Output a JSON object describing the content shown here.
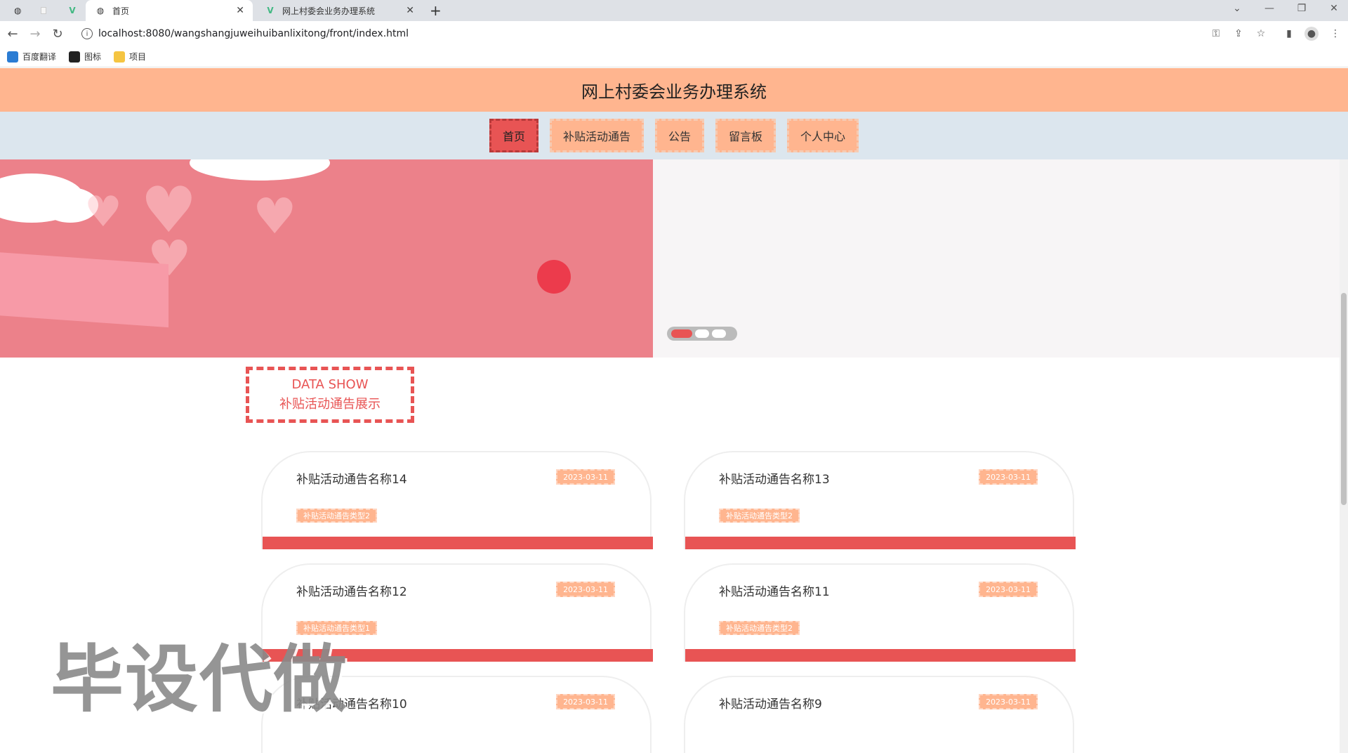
{
  "browser": {
    "tabs": [
      {
        "title": "首页",
        "active": true
      },
      {
        "title": "网上村委会业务办理系统",
        "active": false
      }
    ],
    "new_tab": "+",
    "url": "localhost:8080/wangshangjuweihuibanlixitong/front/index.html",
    "bookmarks": [
      {
        "label": "百度翻译",
        "icon": "translate-icon",
        "color": "#2b7cd3"
      },
      {
        "label": "图标",
        "icon": "image-icon",
        "color": "#222222"
      },
      {
        "label": "项目",
        "icon": "folder-icon",
        "color": "#f5c542"
      }
    ]
  },
  "site": {
    "title": "网上村委会业务办理系统",
    "nav": [
      {
        "label": "首页",
        "active": true
      },
      {
        "label": "补贴活动通告",
        "active": false
      },
      {
        "label": "公告",
        "active": false
      },
      {
        "label": "留言板",
        "active": false
      },
      {
        "label": "个人中心",
        "active": false
      }
    ],
    "carousel": {
      "slide_count": 3,
      "active_index": 0
    }
  },
  "section": {
    "title_en": "DATA SHOW",
    "title_cn": "补贴活动通告展示"
  },
  "cards": [
    {
      "title": "补贴活动通告名称14",
      "date": "2023-03-11",
      "type": "补贴活动通告类型2"
    },
    {
      "title": "补贴活动通告名称13",
      "date": "2023-03-11",
      "type": "补贴活动通告类型2"
    },
    {
      "title": "补贴活动通告名称12",
      "date": "2023-03-11",
      "type": "补贴活动通告类型1"
    },
    {
      "title": "补贴活动通告名称11",
      "date": "2023-03-11",
      "type": "补贴活动通告类型2"
    },
    {
      "title": "补贴活动通告名称10",
      "date": "2023-03-11",
      "type": ""
    },
    {
      "title": "补贴活动通告名称9",
      "date": "2023-03-11",
      "type": ""
    }
  ],
  "watermark": "毕设代做",
  "colors": {
    "header": "#ffb58f",
    "nav_bg": "#dce6ee",
    "accent": "#e85454"
  }
}
